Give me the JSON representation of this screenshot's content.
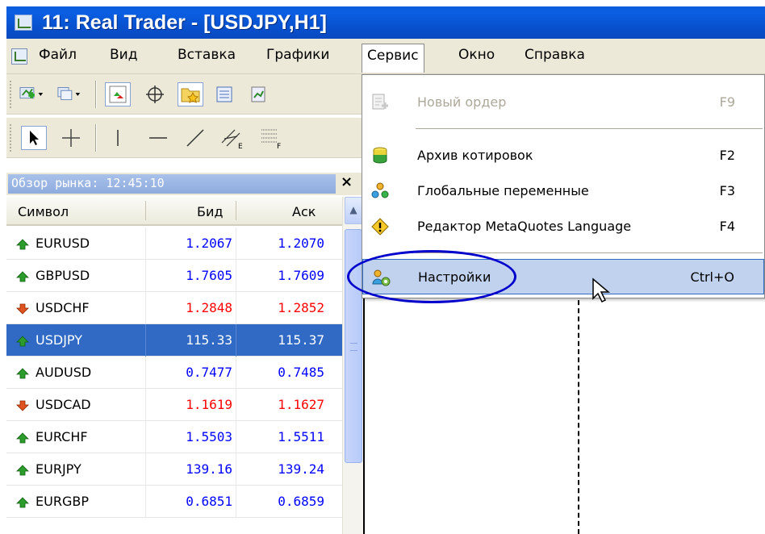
{
  "window": {
    "title": "11: Real Trader - [USDJPY,H1]"
  },
  "menubar": {
    "items": [
      {
        "label": "Файл"
      },
      {
        "label": "Вид"
      },
      {
        "label": "Вставка"
      },
      {
        "label": "Графики"
      },
      {
        "label": "Сервис"
      },
      {
        "label": "Окно"
      },
      {
        "label": "Справка"
      }
    ],
    "active": "Сервис"
  },
  "market_watch": {
    "title": "Обзор рынка: 12:45:10",
    "close": "×",
    "columns": {
      "symbol": "Символ",
      "bid": "Бид",
      "ask": "Аск"
    },
    "rows": [
      {
        "symbol": "EURUSD",
        "bid": "1.2067",
        "ask": "1.2070",
        "dir": "up"
      },
      {
        "symbol": "GBPUSD",
        "bid": "1.7605",
        "ask": "1.7609",
        "dir": "up"
      },
      {
        "symbol": "USDCHF",
        "bid": "1.2848",
        "ask": "1.2852",
        "dir": "down"
      },
      {
        "symbol": "USDJPY",
        "bid": "115.33",
        "ask": "115.37",
        "dir": "up",
        "selected": true
      },
      {
        "symbol": "AUDUSD",
        "bid": "0.7477",
        "ask": "0.7485",
        "dir": "up"
      },
      {
        "symbol": "USDCAD",
        "bid": "1.1619",
        "ask": "1.1627",
        "dir": "down"
      },
      {
        "symbol": "EURCHF",
        "bid": "1.5503",
        "ask": "1.5511",
        "dir": "up"
      },
      {
        "symbol": "EURJPY",
        "bid": "139.16",
        "ask": "139.24",
        "dir": "up"
      },
      {
        "symbol": "EURGBP",
        "bid": "0.6851",
        "ask": "0.6859",
        "dir": "up"
      }
    ]
  },
  "service_menu": {
    "items": [
      {
        "label": "Новый ордер",
        "shortcut": "F9",
        "disabled": true,
        "icon": "new-order-icon"
      },
      {
        "label": "Архив котировок",
        "shortcut": "F2",
        "icon": "history-center-icon"
      },
      {
        "label": "Глобальные переменные",
        "shortcut": "F3",
        "icon": "global-variables-icon"
      },
      {
        "label": "Редактор MetaQuotes Language",
        "shortcut": "F4",
        "icon": "metaeditor-icon"
      },
      {
        "label": "Настройки",
        "shortcut": "Ctrl+O",
        "icon": "options-icon",
        "highlighted": true
      }
    ]
  },
  "colors": {
    "titlebar": "#0a5ddd",
    "up": "#0000ff",
    "down": "#ff0000",
    "selection": "#316ac5",
    "annotation": "#0000cc"
  }
}
